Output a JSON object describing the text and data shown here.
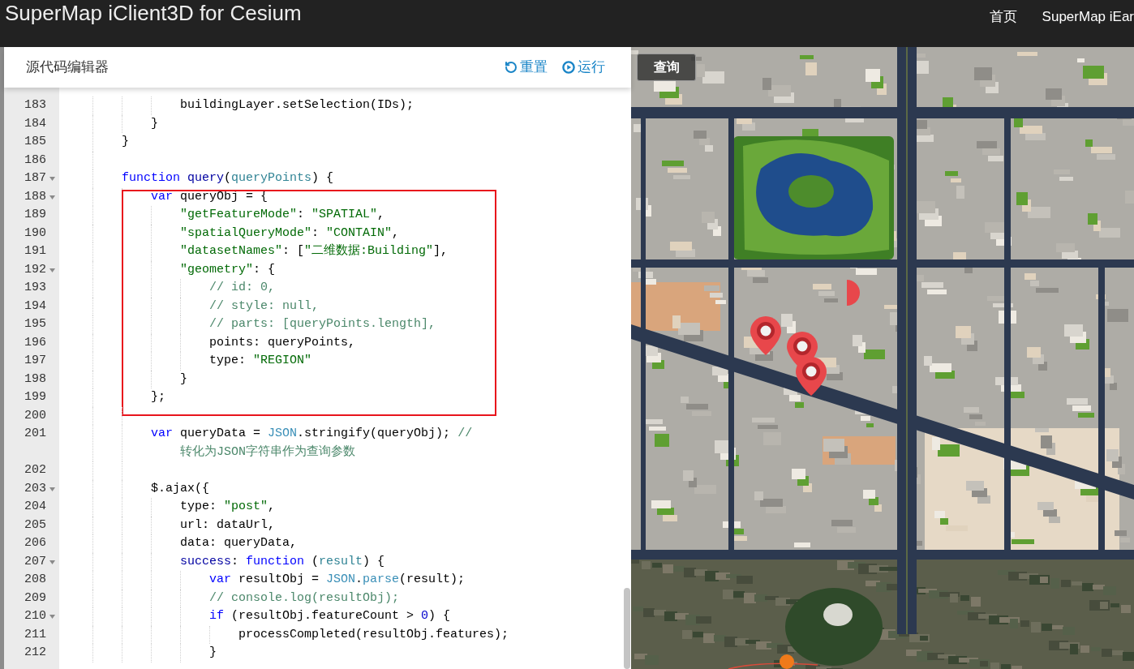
{
  "header": {
    "title": "SuperMap iClient3D for Cesium",
    "nav": [
      {
        "label": "首页"
      },
      {
        "label": "SuperMap iEar"
      }
    ]
  },
  "editor": {
    "title": "源代码编辑器",
    "actions": [
      {
        "kind": "reset",
        "label": "重置"
      },
      {
        "kind": "run",
        "label": "运行"
      }
    ],
    "code": [
      {
        "kind": "offscreen_parent",
        "children": [
          {
            "kind": "offscreen_parent",
            "children": [
              {
                "kind": "line",
                "number": "183",
                "foldable": false,
                "tokens": [
                  {
                    "kind": "plain",
                    "text": "buildingLayer.setSelection(IDs);"
                  }
                ]
              }
            ]
          },
          {
            "kind": "line",
            "number": "184",
            "foldable": false,
            "tokens": [
              {
                "kind": "plain",
                "text": "}"
              }
            ]
          }
        ]
      },
      {
        "kind": "line",
        "number": "185",
        "foldable": false,
        "tokens": [
          {
            "kind": "plain",
            "text": "}"
          }
        ]
      },
      {
        "kind": "line",
        "number": "186",
        "foldable": false
      },
      {
        "kind": "line",
        "number": "187",
        "foldable": true,
        "tokens": [
          {
            "kind": "keyword",
            "text": "function "
          },
          {
            "kind": "entity",
            "text": "query"
          },
          {
            "kind": "plain",
            "text": "("
          },
          {
            "kind": "param",
            "text": "queryPoints"
          },
          {
            "kind": "plain",
            "text": ") {"
          }
        ],
        "children": [
          {
            "kind": "marked_region",
            "lines": [
              {
                "kind": "line",
                "number": "188",
                "foldable": true,
                "tokens": [
                  {
                    "kind": "keyword",
                    "text": "var"
                  },
                  {
                    "kind": "plain",
                    "text": " queryObj = {"
                  }
                ],
                "children": [
                  {
                    "kind": "line",
                    "number": "189",
                    "foldable": false,
                    "tokens": [
                      {
                        "kind": "string",
                        "text": "\"getFeatureMode\""
                      },
                      {
                        "kind": "plain",
                        "text": ": "
                      },
                      {
                        "kind": "string",
                        "text": "\"SPATIAL\""
                      },
                      {
                        "kind": "plain",
                        "text": ","
                      }
                    ]
                  },
                  {
                    "kind": "line",
                    "number": "190",
                    "foldable": false,
                    "tokens": [
                      {
                        "kind": "string",
                        "text": "\"spatialQueryMode\""
                      },
                      {
                        "kind": "plain",
                        "text": ": "
                      },
                      {
                        "kind": "string",
                        "text": "\"CONTAIN\""
                      },
                      {
                        "kind": "plain",
                        "text": ","
                      }
                    ]
                  },
                  {
                    "kind": "line",
                    "number": "191",
                    "foldable": false,
                    "tokens": [
                      {
                        "kind": "string",
                        "text": "\"datasetNames\""
                      },
                      {
                        "kind": "plain",
                        "text": ": ["
                      },
                      {
                        "kind": "string",
                        "text": "\"二维数据:Building\""
                      },
                      {
                        "kind": "plain",
                        "text": "],"
                      }
                    ]
                  },
                  {
                    "kind": "line",
                    "number": "192",
                    "foldable": true,
                    "tokens": [
                      {
                        "kind": "string",
                        "text": "\"geometry\""
                      },
                      {
                        "kind": "plain",
                        "text": ": {"
                      }
                    ],
                    "children": [
                      {
                        "kind": "line",
                        "number": "193",
                        "foldable": false,
                        "tokens": [
                          {
                            "kind": "comment",
                            "text": "// id: 0,"
                          }
                        ]
                      },
                      {
                        "kind": "line",
                        "number": "194",
                        "foldable": false,
                        "tokens": [
                          {
                            "kind": "comment",
                            "text": "// style: null,"
                          }
                        ]
                      },
                      {
                        "kind": "line",
                        "number": "195",
                        "foldable": false,
                        "tokens": [
                          {
                            "kind": "comment",
                            "text": "// parts: [queryPoints.length],"
                          }
                        ]
                      },
                      {
                        "kind": "line",
                        "number": "196",
                        "foldable": false,
                        "tokens": [
                          {
                            "kind": "plain",
                            "text": "points: queryPoints,"
                          }
                        ]
                      },
                      {
                        "kind": "line",
                        "number": "197",
                        "foldable": false,
                        "tokens": [
                          {
                            "kind": "plain",
                            "text": "type: "
                          },
                          {
                            "kind": "string",
                            "text": "\"REGION\""
                          }
                        ]
                      }
                    ]
                  },
                  {
                    "kind": "line",
                    "number": "198",
                    "foldable": false,
                    "tokens": [
                      {
                        "kind": "plain",
                        "text": "}"
                      }
                    ]
                  }
                ]
              },
              {
                "kind": "line",
                "number": "199",
                "foldable": false,
                "tokens": [
                  {
                    "kind": "plain",
                    "text": "};"
                  }
                ]
              }
            ]
          },
          {
            "kind": "line",
            "number": "200",
            "foldable": false
          },
          {
            "kind": "line",
            "number": "201",
            "foldable": false,
            "tokens": [
              {
                "kind": "keyword",
                "text": "var"
              },
              {
                "kind": "plain",
                "text": " queryData = "
              },
              {
                "kind": "support",
                "text": "JSON"
              },
              {
                "kind": "plain",
                "text": ".stringify(queryObj); "
              },
              {
                "kind": "comment",
                "text": "//"
              }
            ],
            "wrapped_tokens": [
              {
                "kind": "comment",
                "text": "转化为JSON字符串作为查询参数"
              }
            ]
          },
          {
            "kind": "line",
            "number": "202",
            "foldable": false
          },
          {
            "kind": "line",
            "number": "203",
            "foldable": true,
            "tokens": [
              {
                "kind": "plain",
                "text": "$.ajax({"
              }
            ],
            "children": [
              {
                "kind": "line",
                "number": "204",
                "foldable": false,
                "tokens": [
                  {
                    "kind": "plain",
                    "text": "type: "
                  },
                  {
                    "kind": "string",
                    "text": "\"post\""
                  },
                  {
                    "kind": "plain",
                    "text": ","
                  }
                ]
              },
              {
                "kind": "line",
                "number": "205",
                "foldable": false,
                "tokens": [
                  {
                    "kind": "plain",
                    "text": "url: dataUrl,"
                  }
                ]
              },
              {
                "kind": "line",
                "number": "206",
                "foldable": false,
                "tokens": [
                  {
                    "kind": "plain",
                    "text": "data: queryData,"
                  }
                ]
              },
              {
                "kind": "line",
                "number": "207",
                "foldable": true,
                "tokens": [
                  {
                    "kind": "entity",
                    "text": "success"
                  },
                  {
                    "kind": "plain",
                    "text": ": "
                  },
                  {
                    "kind": "keyword",
                    "text": "function"
                  },
                  {
                    "kind": "plain",
                    "text": " ("
                  },
                  {
                    "kind": "param",
                    "text": "result"
                  },
                  {
                    "kind": "plain",
                    "text": ") {"
                  }
                ],
                "children": [
                  {
                    "kind": "line",
                    "number": "208",
                    "foldable": false,
                    "tokens": [
                      {
                        "kind": "keyword",
                        "text": "var"
                      },
                      {
                        "kind": "plain",
                        "text": " resultObj = "
                      },
                      {
                        "kind": "support",
                        "text": "JSON"
                      },
                      {
                        "kind": "plain",
                        "text": "."
                      },
                      {
                        "kind": "support",
                        "text": "parse"
                      },
                      {
                        "kind": "plain",
                        "text": "(result);"
                      }
                    ]
                  },
                  {
                    "kind": "line",
                    "number": "209",
                    "foldable": false,
                    "tokens": [
                      {
                        "kind": "comment",
                        "text": "// console.log(resultObj);"
                      }
                    ]
                  },
                  {
                    "kind": "line",
                    "number": "210",
                    "foldable": true,
                    "tokens": [
                      {
                        "kind": "keyword",
                        "text": "if"
                      },
                      {
                        "kind": "plain",
                        "text": " (resultObj.featureCount > "
                      },
                      {
                        "kind": "number",
                        "text": "0"
                      },
                      {
                        "kind": "plain",
                        "text": ") {"
                      }
                    ],
                    "children": [
                      {
                        "kind": "line",
                        "number": "211",
                        "foldable": false,
                        "tokens": [
                          {
                            "kind": "plain",
                            "text": "processCompleted(resultObj.features);"
                          }
                        ]
                      }
                    ]
                  },
                  {
                    "kind": "line",
                    "number": "212",
                    "foldable": false,
                    "tokens": [
                      {
                        "kind": "plain",
                        "text": "}"
                      }
                    ]
                  }
                ]
              }
            ]
          }
        ]
      }
    ]
  },
  "map": {
    "query_button": {
      "label": "查询"
    }
  }
}
